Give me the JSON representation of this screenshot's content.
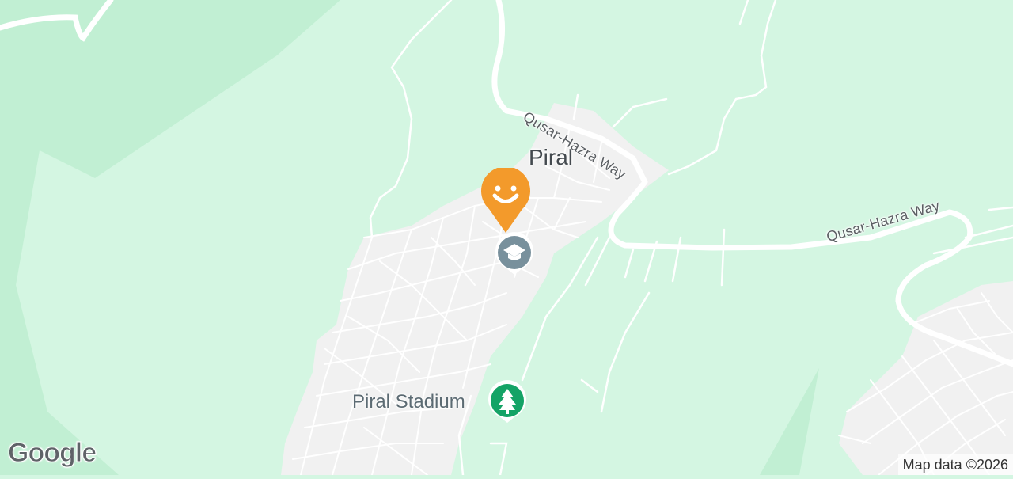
{
  "map": {
    "town_label": "Piral",
    "poi_label": "Piral Stadium",
    "road_labels": [
      "Qusar-Hazra Way",
      "Qusar-Hazra Way"
    ],
    "attribution": "Map data ©2026",
    "logo_text": "Google",
    "icons": [
      "smiley-pin-icon",
      "school-pin-icon",
      "park-pin-icon"
    ],
    "colors": {
      "background": "#d4f6e2",
      "forest": "#c1efd3",
      "urban": "#f1f1f1",
      "road": "#ffffff",
      "smiley_pin": "#f39a2b",
      "school_pin": "#78909c",
      "park_pin": "#14a366"
    }
  }
}
